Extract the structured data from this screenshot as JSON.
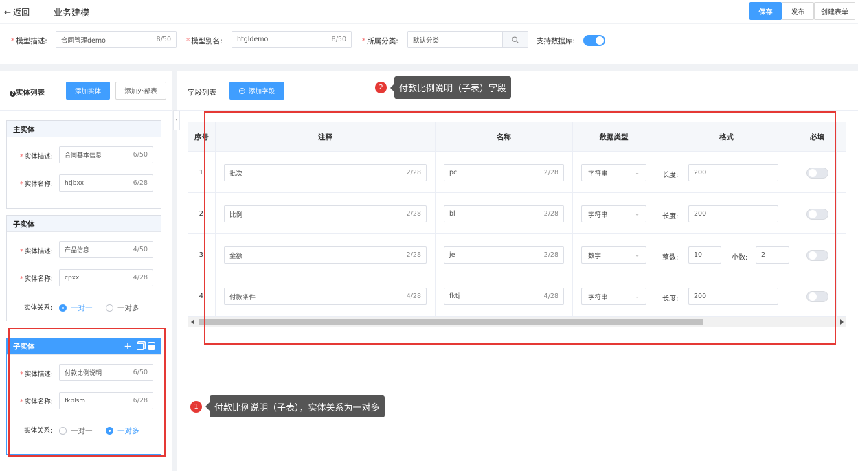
{
  "header": {
    "back_label": "返回",
    "title": "业务建模",
    "save_label": "保存",
    "publish_label": "发布",
    "create_form_label": "创建表单"
  },
  "model": {
    "desc_label": "模型描述:",
    "desc_value": "合同管理demo",
    "desc_count": "8/50",
    "alias_label": "模型别名:",
    "alias_value": "htgldemo",
    "alias_count": "8/50",
    "category_label": "所属分类:",
    "category_value": "默认分类",
    "db_label": "支持数据库:",
    "db_enabled": true
  },
  "entities": {
    "title": "实体列表",
    "add_entity_label": "添加实体",
    "add_external_label": "添加外部表",
    "desc_label": "实体描述:",
    "name_label": "实体名称:",
    "relation_label": "实体关系:",
    "one_to_one": "一对一",
    "one_to_many": "一对多",
    "main": {
      "title": "主实体",
      "desc": "合同基本信息",
      "desc_count": "6/50",
      "name": "htjbxx",
      "name_count": "6/28"
    },
    "children": [
      {
        "title": "子实体",
        "desc": "产品信息",
        "desc_count": "4/50",
        "name": "cpxx",
        "name_count": "4/28",
        "relation": "one_to_one"
      },
      {
        "title": "子实体",
        "desc": "付款比例说明",
        "desc_count": "6/50",
        "name": "fkblsm",
        "name_count": "6/28",
        "relation": "one_to_many"
      }
    ]
  },
  "fields": {
    "title": "字段列表",
    "add_field_label": "添加字段",
    "columns": [
      "序号",
      "注释",
      "名称",
      "数据类型",
      "格式",
      "必填"
    ],
    "length_label": "长度:",
    "integer_label": "整数:",
    "decimal_label": "小数:",
    "rows": [
      {
        "index": "1",
        "comment": "批次",
        "comment_count": "2/28",
        "name": "pc",
        "name_count": "2/28",
        "type": "字符串",
        "length": "200",
        "required": false
      },
      {
        "index": "2",
        "comment": "比例",
        "comment_count": "2/28",
        "name": "bl",
        "name_count": "2/28",
        "type": "字符串",
        "length": "200",
        "required": false
      },
      {
        "index": "3",
        "comment": "金额",
        "comment_count": "2/28",
        "name": "je",
        "name_count": "2/28",
        "type": "数字",
        "integer": "10",
        "decimal": "2",
        "required": false
      },
      {
        "index": "4",
        "comment": "付款条件",
        "comment_count": "4/28",
        "name": "fktj",
        "name_count": "4/28",
        "type": "字符串",
        "length": "200",
        "required": false
      }
    ]
  },
  "annotations": [
    {
      "number": "1",
      "text": "付款比例说明（子表），实体关系为一对多"
    },
    {
      "number": "2",
      "text": "付款比例说明（子表）字段"
    }
  ],
  "colors": {
    "accent": "#409eff",
    "annotation_red": "#e53935",
    "callout_bg": "#555555"
  }
}
